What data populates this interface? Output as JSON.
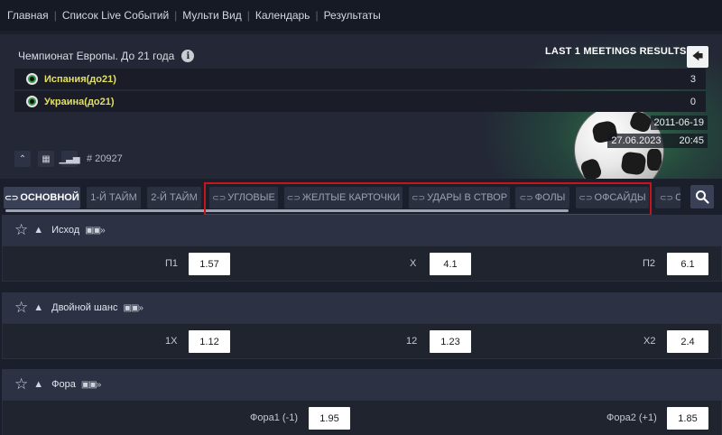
{
  "topnav": {
    "items": [
      "Главная",
      "Список Live Событий",
      "Мульти Вид",
      "Календарь",
      "Результаты"
    ],
    "separator": "|"
  },
  "match": {
    "league": "Чемпионат Европы. До 21 года",
    "meetings_title": "LAST 1 MEETINGS RESULTS",
    "teams": [
      {
        "name": "Испания(до21)",
        "score": "3"
      },
      {
        "name": "Украина(до21)",
        "score": "0"
      }
    ],
    "last_meeting_date": "2011-06-19",
    "match_date": "27.06.2023",
    "match_time": "20:45",
    "match_id": "# 20927"
  },
  "tabs": [
    {
      "label": "ОСНОВНОЙ",
      "active": true
    },
    {
      "label": "1-Й ТАЙМ"
    },
    {
      "label": "2-Й ТАЙМ"
    },
    {
      "label": "УГЛОВЫЕ"
    },
    {
      "label": "ЖЕЛТЫЕ КАРТОЧКИ"
    },
    {
      "label": "УДАРЫ В СТВОР"
    },
    {
      "label": "ФОЛЫ"
    },
    {
      "label": "ОФСАЙДЫ"
    },
    {
      "label": "С"
    }
  ],
  "markets": [
    {
      "title": "Исход",
      "outcomes": [
        {
          "label": "П1",
          "odd": "1.57"
        },
        {
          "label": "X",
          "odd": "4.1"
        },
        {
          "label": "П2",
          "odd": "6.1"
        }
      ]
    },
    {
      "title": "Двойной шанс",
      "outcomes": [
        {
          "label": "1X",
          "odd": "1.12"
        },
        {
          "label": "12",
          "odd": "1.23"
        },
        {
          "label": "X2",
          "odd": "2.4"
        }
      ]
    },
    {
      "title": "Фора",
      "outcomes": [
        {
          "label": "Фора1 (-1)",
          "odd": "1.95"
        },
        {
          "label": "Фора2 (+1)",
          "odd": "1.85"
        }
      ]
    }
  ],
  "colors": {
    "highlight": "#c8151c",
    "team_name": "#e3e060",
    "background": "#1b1f2b"
  }
}
